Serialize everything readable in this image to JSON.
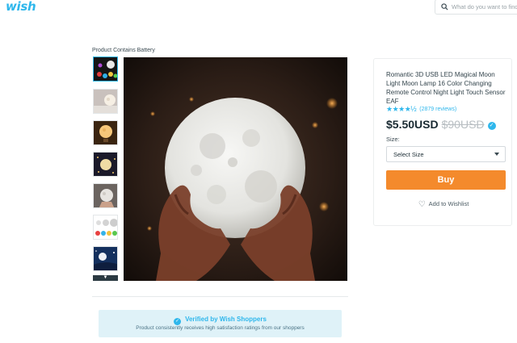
{
  "header": {
    "logo": "wish",
    "search_placeholder": "What do you want to find?",
    "search_icon": "search-icon"
  },
  "product": {
    "battery_notice": "Product Contains Battery",
    "title": "Romantic 3D USB LED Magical Moon Light Moon Lamp 16 Color Changing Remote Control Night Light Touch Sensor EAF",
    "stars": "★★★★½",
    "rating_value": 4.5,
    "reviews": "(2879 reviews)",
    "price": "$5.50USD",
    "original_price": "$90USD",
    "size_label": "Size:",
    "size_selected": "Select Size",
    "buy_label": "Buy",
    "wishlist_label": "Add to Wishlist"
  },
  "thumbnails": [
    "thumb-color-moons",
    "thumb-moon-room",
    "thumb-moon-stand",
    "thumb-moon-night",
    "thumb-moon-hand",
    "thumb-moon-sizes",
    "thumb-moon-sky"
  ],
  "verified": {
    "title": "Verified by Wish Shoppers",
    "subtitle": "Product consistently receives high satisfaction ratings from our shoppers"
  },
  "colors": {
    "brand": "#2fb7ec",
    "buy_button": "#f48a2c",
    "verified_bg": "#dff2f8"
  }
}
